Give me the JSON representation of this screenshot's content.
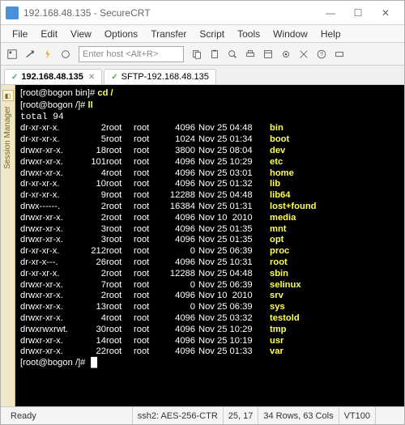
{
  "window": {
    "title": "192.168.48.135 - SecureCRT",
    "min": "—",
    "max": "☐",
    "close": "✕"
  },
  "menu": [
    "File",
    "Edit",
    "View",
    "Options",
    "Transfer",
    "Script",
    "Tools",
    "Window",
    "Help"
  ],
  "hostbox_placeholder": "Enter host <Alt+R>",
  "tabs": [
    {
      "label": "192.168.48.135",
      "bold": true
    },
    {
      "label": "SFTP-192.168.48.135",
      "bold": false
    }
  ],
  "side_label": "Session Manager",
  "terminal": {
    "prompt1": "[root@bogon bin]#",
    "cmd1": " cd /",
    "prompt2": "[root@bogon /]#",
    "cmd2": " ll",
    "total": "total 94",
    "rows": [
      {
        "perm": "dr-xr-xr-x.",
        "links": "2",
        "o1": "root",
        "o2": "root",
        "size": "4096",
        "date": "Nov 25 04:48",
        "name": "bin"
      },
      {
        "perm": "dr-xr-xr-x.",
        "links": "5",
        "o1": "root",
        "o2": "root",
        "size": "1024",
        "date": "Nov 25 01:34",
        "name": "boot"
      },
      {
        "perm": "drwxr-xr-x.",
        "links": "18",
        "o1": "root",
        "o2": "root",
        "size": "3800",
        "date": "Nov 25 08:04",
        "name": "dev"
      },
      {
        "perm": "drwxr-xr-x.",
        "links": "101",
        "o1": "root",
        "o2": "root",
        "size": "4096",
        "date": "Nov 25 10:29",
        "name": "etc"
      },
      {
        "perm": "drwxr-xr-x.",
        "links": "4",
        "o1": "root",
        "o2": "root",
        "size": "4096",
        "date": "Nov 25 03:01",
        "name": "home"
      },
      {
        "perm": "dr-xr-xr-x.",
        "links": "10",
        "o1": "root",
        "o2": "root",
        "size": "4096",
        "date": "Nov 25 01:32",
        "name": "lib"
      },
      {
        "perm": "dr-xr-xr-x.",
        "links": "9",
        "o1": "root",
        "o2": "root",
        "size": "12288",
        "date": "Nov 25 04:48",
        "name": "lib64"
      },
      {
        "perm": "drwx------.",
        "links": "2",
        "o1": "root",
        "o2": "root",
        "size": "16384",
        "date": "Nov 25 01:31",
        "name": "lost+found"
      },
      {
        "perm": "drwxr-xr-x.",
        "links": "2",
        "o1": "root",
        "o2": "root",
        "size": "4096",
        "date": "Nov 10  2010",
        "name": "media"
      },
      {
        "perm": "drwxr-xr-x.",
        "links": "3",
        "o1": "root",
        "o2": "root",
        "size": "4096",
        "date": "Nov 25 01:35",
        "name": "mnt"
      },
      {
        "perm": "drwxr-xr-x.",
        "links": "3",
        "o1": "root",
        "o2": "root",
        "size": "4096",
        "date": "Nov 25 01:35",
        "name": "opt"
      },
      {
        "perm": "dr-xr-xr-x.",
        "links": "212",
        "o1": "root",
        "o2": "root",
        "size": "0",
        "date": "Nov 25 06:39",
        "name": "proc"
      },
      {
        "perm": "dr-xr-x---.",
        "links": "26",
        "o1": "root",
        "o2": "root",
        "size": "4096",
        "date": "Nov 25 10:31",
        "name": "root"
      },
      {
        "perm": "dr-xr-xr-x.",
        "links": "2",
        "o1": "root",
        "o2": "root",
        "size": "12288",
        "date": "Nov 25 04:48",
        "name": "sbin"
      },
      {
        "perm": "drwxr-xr-x.",
        "links": "7",
        "o1": "root",
        "o2": "root",
        "size": "0",
        "date": "Nov 25 06:39",
        "name": "selinux"
      },
      {
        "perm": "drwxr-xr-x.",
        "links": "2",
        "o1": "root",
        "o2": "root",
        "size": "4096",
        "date": "Nov 10  2010",
        "name": "srv"
      },
      {
        "perm": "drwxr-xr-x.",
        "links": "13",
        "o1": "root",
        "o2": "root",
        "size": "0",
        "date": "Nov 25 06:39",
        "name": "sys"
      },
      {
        "perm": "drwxr-xr-x.",
        "links": "4",
        "o1": "root",
        "o2": "root",
        "size": "4096",
        "date": "Nov 25 03:32",
        "name": "testold"
      },
      {
        "perm": "drwxrwxrwt.",
        "links": "30",
        "o1": "root",
        "o2": "root",
        "size": "4096",
        "date": "Nov 25 10:29",
        "name": "tmp"
      },
      {
        "perm": "drwxr-xr-x.",
        "links": "14",
        "o1": "root",
        "o2": "root",
        "size": "4096",
        "date": "Nov 25 10:19",
        "name": "usr"
      },
      {
        "perm": "drwxr-xr-x.",
        "links": "22",
        "o1": "root",
        "o2": "root",
        "size": "4096",
        "date": "Nov 25 01:33",
        "name": "var"
      }
    ],
    "prompt3": "[root@bogon /]#",
    "cursor": "█"
  },
  "status": {
    "ready": "Ready",
    "cipher": "ssh2: AES-256-CTR",
    "pos": "25,  17",
    "dims": "34 Rows, 63 Cols",
    "emul": "VT100"
  }
}
